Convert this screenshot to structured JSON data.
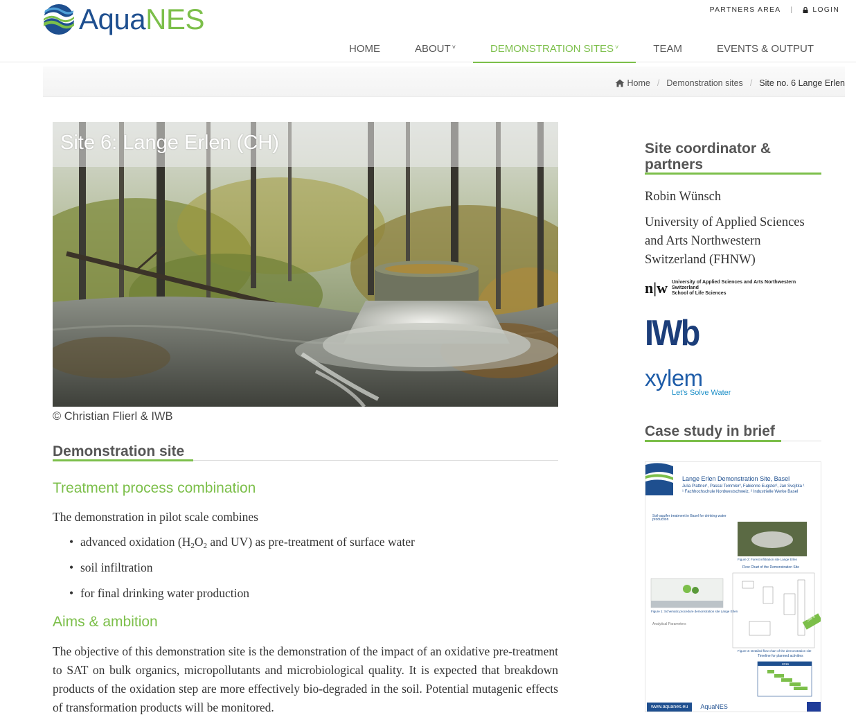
{
  "brand": {
    "name_part1": "Aqua",
    "name_part2": "NES"
  },
  "topbar": {
    "partners": "PARTNERS AREA",
    "login": "LOGIN"
  },
  "nav": [
    {
      "label": "HOME",
      "caret": false,
      "active": false
    },
    {
      "label": "ABOUT",
      "caret": true,
      "active": false
    },
    {
      "label": "DEMONSTRATION SITES",
      "caret": true,
      "active": true
    },
    {
      "label": "TEAM",
      "caret": false,
      "active": false
    },
    {
      "label": "EVENTS & OUTPUT",
      "caret": false,
      "active": false
    }
  ],
  "breadcrumb": {
    "home": "Home",
    "level1": "Demonstration sites",
    "current": "Site no. 6 Lange Erlen"
  },
  "hero": {
    "title": "Site 6: Lange Erlen (CH)",
    "credit": "© Christian Flierl & IWB"
  },
  "content": {
    "section_title": "Demonstration site",
    "treatment_heading": "Treatment process combination",
    "treatment_intro": "The demonstration in pilot scale combines",
    "bullet1_pre": "advanced oxidation  (H",
    "bullet1_sub1": "2",
    "bullet1_mid": "O",
    "bullet1_sub2": "2",
    "bullet1_post": " and UV) as pre-treatment of surface water",
    "bullet2": "soil infiltration",
    "bullet3": "for final drinking water production",
    "aims_heading": "Aims & ambition",
    "aims_text": "The objective of this demonstration site is the demonstration of the impact of an oxidative pre-treatment to SAT on bulk organics, micropollutants and microbiological quality. It is expected that breakdown products of the oxidation step are more effectively bio-degraded in the soil. Potential mutagenic effects of transformation products will be monitored."
  },
  "sidebar": {
    "coord_heading_line1": "Site coordinator &",
    "coord_heading_line2": "partners",
    "coordinator": "Robin Wünsch",
    "institution": "University of Applied Sciences and Arts Northwestern Switzerland (FHNW)",
    "fhnw_logo": {
      "mark": "n|w",
      "line1": "University of Applied Sciences and Arts Northwestern Switzerland",
      "line2": "School of Life Sciences"
    },
    "iwb_logo": "IWb",
    "xylem_logo": {
      "name": "xylem",
      "tagline": "Let's Solve Water"
    },
    "case_heading": "Case study in brief",
    "poster": {
      "title": "Lange Erlen Demonstration Site, Basel",
      "authors": "Julia Plattner¹, Pascal Temmler², Fabienne Eugster², Jan Svojitka ¹",
      "affil": "¹ Fachhochschule Nordwestschweiz, ² Industrielle Werke Basel",
      "section1": "Soil-aquifer treatment in Basel for drinking water production",
      "fig1": "Figure 1: Schematic procedure demonstration site Lange Erlen",
      "fig2": "Figure 2: Forest infiltration site Lange Erlen",
      "flow": "Flow Chart of the Demonstration Site",
      "fig3": "Figure 3: Detailed flow chart of the demonstration site",
      "params": "Analytical Parameters",
      "timeline": "Timeline for planned activities",
      "year": "2016",
      "badge": "Site 6",
      "url": "www.aquanes.eu",
      "brand": "AquaNES"
    }
  },
  "colors": {
    "green": "#7cbf4a",
    "blue": "#1e4f8f",
    "iwb": "#1c3e7a",
    "xylem": "#1e5ca8"
  },
  "icons": [
    "aquanes-logo-icon",
    "lock-icon",
    "home-icon",
    "chevron-down-icon",
    "eu-flag-icon"
  ]
}
